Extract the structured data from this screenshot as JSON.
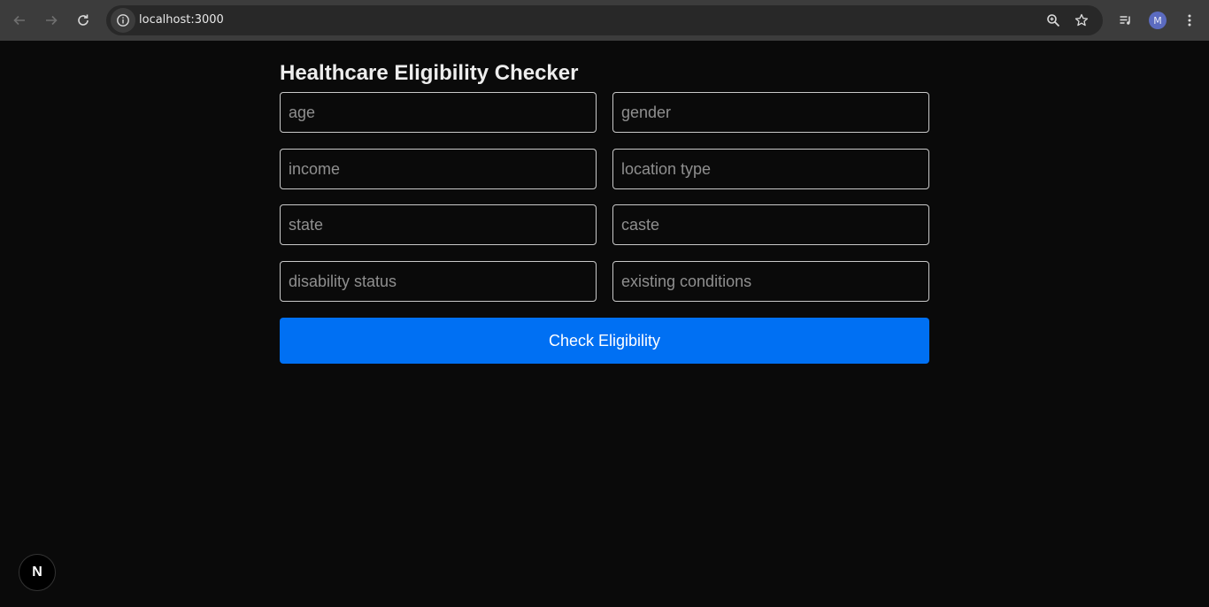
{
  "browser": {
    "url": "localhost:3000",
    "profile_initial": "M",
    "icons": {
      "back": "back-arrow-icon",
      "forward": "forward-arrow-icon",
      "reload": "reload-icon",
      "site_info": "info-icon",
      "zoom": "zoom-icon",
      "bookmark": "star-icon",
      "media": "media-queue-icon",
      "menu": "kebab-menu-icon"
    }
  },
  "page": {
    "title": "Healthcare Eligibility Checker",
    "fields": {
      "age": "age",
      "gender": "gender",
      "income": "income",
      "location_type": "location type",
      "state": "state",
      "caste": "caste",
      "disability_status": "disability status",
      "existing_conditions": "existing conditions"
    },
    "submit_label": "Check Eligibility",
    "accent_color": "#0070f3"
  },
  "dev_badge": {
    "label": "N"
  }
}
